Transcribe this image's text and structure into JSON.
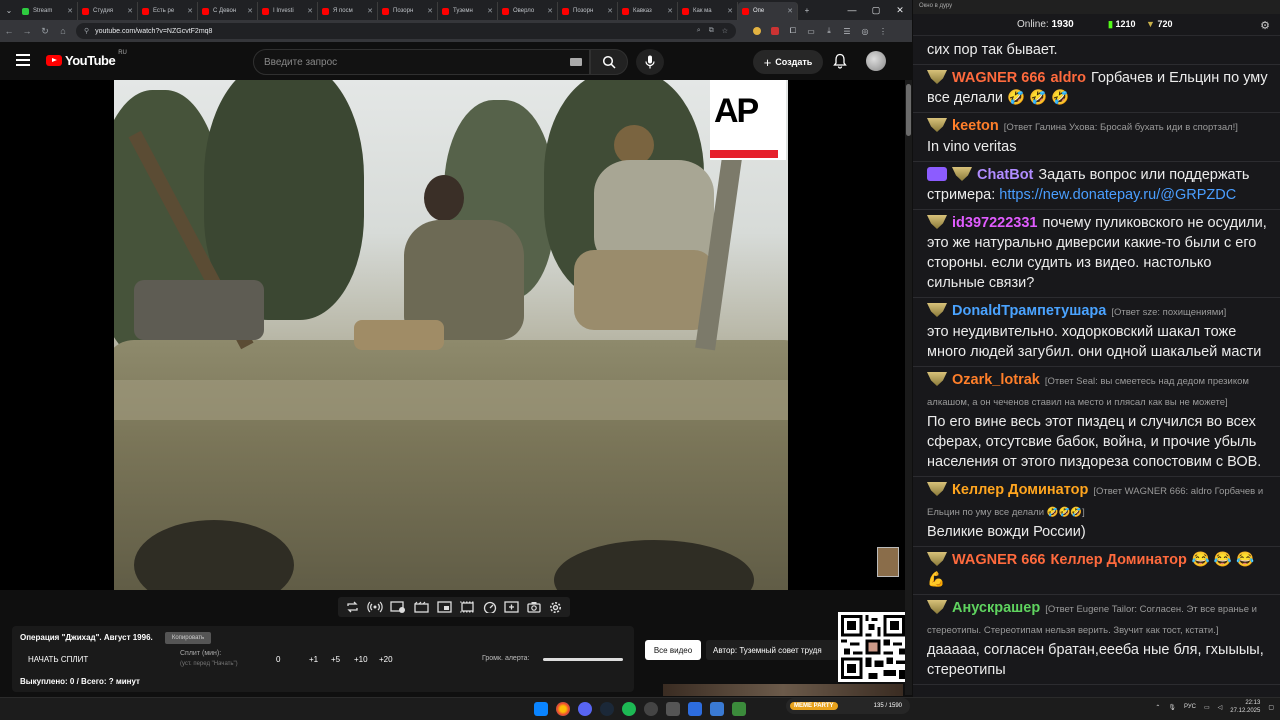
{
  "browser": {
    "tabs": [
      {
        "title": "Stream",
        "color": "#2ecc40"
      },
      {
        "title": "Студия",
        "color": "#ff0000"
      },
      {
        "title": "Есть ре",
        "color": "#ff0000"
      },
      {
        "title": "С Девон",
        "color": "#ff0000"
      },
      {
        "title": "I Investi",
        "color": "#ff0000"
      },
      {
        "title": "Я посм",
        "color": "#ff0000"
      },
      {
        "title": "Позорн",
        "color": "#ff0000"
      },
      {
        "title": "Туземн",
        "color": "#ff0000"
      },
      {
        "title": "Оверло",
        "color": "#ff0000"
      },
      {
        "title": "Позорн",
        "color": "#ff0000"
      },
      {
        "title": "Кавказ",
        "color": "#ff0000"
      },
      {
        "title": "Как ма",
        "color": "#ff0000"
      },
      {
        "title": "Опе",
        "color": "#ff0000",
        "active": true
      }
    ],
    "new_tab": "+",
    "url": "youtube.com/watch?v=NZGcvtF2mq8",
    "window_controls": [
      "—",
      "▢",
      "✕"
    ]
  },
  "youtube": {
    "logo_text": "YouTube",
    "logo_region": "RU",
    "search_placeholder": "Введите запрос",
    "create_label": "Создать"
  },
  "video": {
    "watermark": "AP",
    "watermark_bar_color": "#e6202b"
  },
  "controls": {
    "icons": [
      "repeat-icon",
      "broadcast-icon",
      "playlist-icon",
      "clip-icon",
      "resize-icon",
      "film-icon",
      "speed-icon",
      "add-clip-icon",
      "camera-icon",
      "settings-icon"
    ]
  },
  "bottom_panel": {
    "title": "Операция \"Джихад\". Август 1996.",
    "copy_label": "Копировать",
    "start_split": "НАЧАТЬ СПЛИТ",
    "split_label": "Сплит (мин):",
    "split_hint": "(уст. перед \"Начать\")",
    "split_value": "0",
    "split_buttons": [
      "+1",
      "+5",
      "+10",
      "+20"
    ],
    "alert_volume_label": "Громк. алерта:",
    "bought_label": "Выкуплено: 0 / Всего: ? минут",
    "all_videos": "Все видео",
    "author": "Автор: Туземный совет трудя"
  },
  "chat": {
    "window_title": "Окно в дуру",
    "online_label": "Online:",
    "online_count": "1930",
    "stat1": "1210",
    "stat2": "720",
    "messages": [
      {
        "nick": "",
        "nick_color": "#ffffff",
        "reply": "",
        "text": "сих пор так бывает."
      },
      {
        "nick": "WAGNER 666",
        "nick_color": "#ff6a3d",
        "reply": "",
        "mention": "aldro",
        "text": "Горбачев и Ельцин по уму все делали 🤣 🤣 🤣"
      },
      {
        "nick": "keeton",
        "nick_color": "#ff7f2a",
        "reply": "[Ответ Галина Ухова: Бросай бухать иди в спортзал!]",
        "text": "In vino veritas"
      },
      {
        "nick": "ChatBot",
        "nick_color": "#b08cff",
        "reply": "",
        "text": "Задать вопрос или поддержать стримера:",
        "link": "https://new.donatepay.ru/@GRPZDC"
      },
      {
        "nick": "id397222331",
        "nick_color": "#e05cff",
        "reply": "",
        "text": "почему пуликовского не осудили, это же натурально диверсии какие-то были с его стороны. если судить из видео. настолько сильные связи?"
      },
      {
        "nick": "DonaldТрампетушара",
        "nick_color": "#4aa3ff",
        "reply": "[Ответ sze: похищениями]",
        "text": "это неудивительно. ходорковский шакал тоже много людей загубил. они одной шакальей масти"
      },
      {
        "nick": "Ozark_lotrak",
        "nick_color": "#ff7f2a",
        "reply": "[Ответ Seal: вы смеетесь над дедом презиком алкашом, а он чеченов ставил на место и плясал как вы не можете]",
        "text": "По его вине весь этот пиздец и случился во всех сферах, отсутсвие бабок, война, и прочие убыль населения от этого пиздореза сопостовим с ВОВ."
      },
      {
        "nick": "Келлер Доминатор",
        "nick_color": "#ffa51f",
        "reply": "[Ответ WAGNER 666: aldro Горбачев и Ельцин по уму все делали 🤣🤣🤣]",
        "text": "Великие вожди России)"
      },
      {
        "nick": "WAGNER 666",
        "nick_color": "#ff6a3d",
        "reply": "",
        "mention": "Келлер Доминатор",
        "text": "😂 😂 😂 💪"
      },
      {
        "nick": "Анускрашер",
        "nick_color": "#5fd35f",
        "reply": "[Ответ Eugene Tailor: Согласен. Эт все вранье и стереотипы. Стереотипам нельзя верить. Звучит как тост, кстати.]",
        "text": "дааааа, согласен братан,еееба ные бля, гхыыыы, стереотипы"
      }
    ]
  },
  "taskbar": {
    "meme_party": "MEME PARTY",
    "meme_count": "135 / 1590",
    "lang": "РУС",
    "time": "22:13",
    "date": "27.12.2025"
  }
}
